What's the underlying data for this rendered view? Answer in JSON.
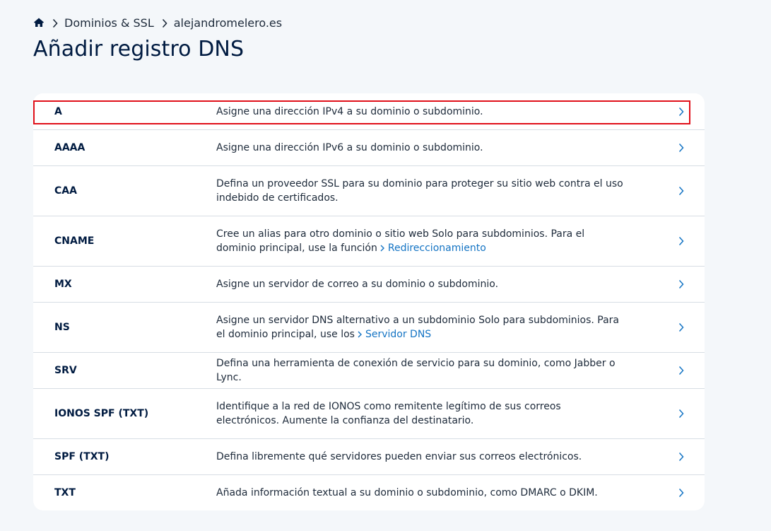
{
  "breadcrumb": {
    "items": [
      "Dominios & SSL",
      "alejandromelero.es"
    ]
  },
  "page": {
    "title": "Añadir registro DNS"
  },
  "records": [
    {
      "type": "A",
      "description": "Asigne una dirección IPv4 a su dominio o subdominio."
    },
    {
      "type": "AAAA",
      "description": "Asigne una dirección IPv6 a su dominio o subdominio."
    },
    {
      "type": "CAA",
      "description": "Defina un proveedor SSL para su dominio para proteger su sitio web contra el uso indebido de certificados."
    },
    {
      "type": "CNAME",
      "description": "Cree un alias para otro dominio o sitio web Solo para subdominios. Para el dominio principal, use la función",
      "link": "Redireccionamiento"
    },
    {
      "type": "MX",
      "description": "Asigne un servidor de correo a su dominio o subdominio."
    },
    {
      "type": "NS",
      "description": "Asigne un servidor DNS alternativo a un subdominio Solo para subdominios. Para el dominio principal, use los",
      "link": "Servidor DNS"
    },
    {
      "type": "SRV",
      "description": "Defina una herramienta de conexión de servicio para su dominio, como Jabber o Lync."
    },
    {
      "type": "IONOS SPF (TXT)",
      "description": "Identifique a la red de IONOS como remitente legítimo de sus correos electrónicos. Aumente la confianza del destinatario."
    },
    {
      "type": "SPF (TXT)",
      "description": "Defina libremente qué servidores pueden enviar sus correos electrónicos."
    },
    {
      "type": "TXT",
      "description": "Añada información textual a su dominio o subdominio, como DMARC o DKIM."
    }
  ],
  "colors": {
    "background": "#f4f7fa",
    "text": "#001b41",
    "link": "#1474c4",
    "highlight": "#e0101a"
  }
}
